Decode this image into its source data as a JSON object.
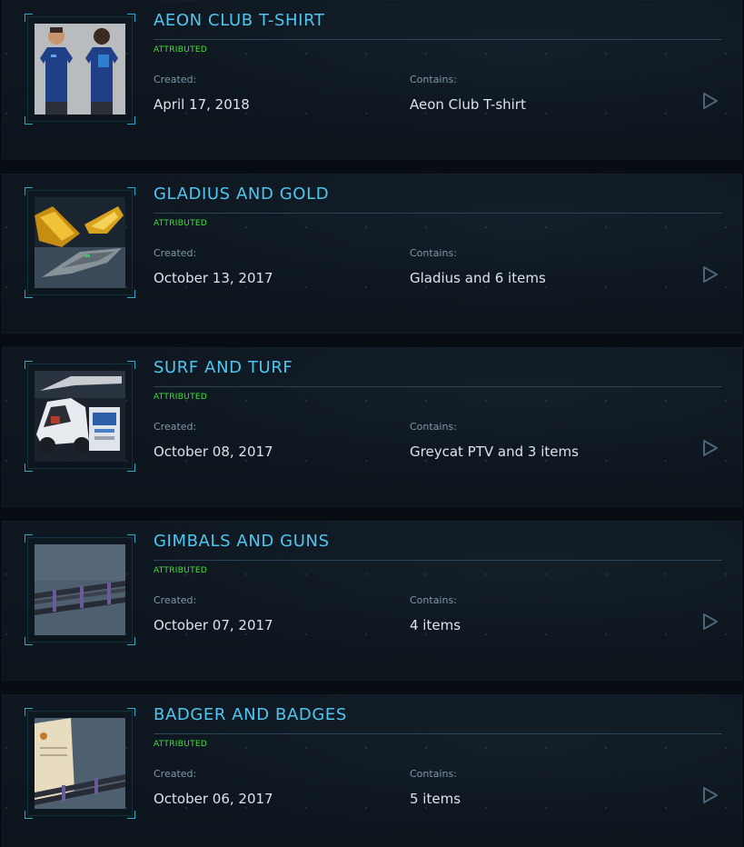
{
  "pledges": [
    {
      "title": "AEON CLUB T-SHIRT",
      "status": "ATTRIBUTED",
      "created_label": "Created:",
      "created": "April 17, 2018",
      "contains_label": "Contains:",
      "contains": "Aeon Club T-shirt",
      "thumbnail": "t-shirt-image"
    },
    {
      "title": "GLADIUS AND GOLD",
      "status": "ATTRIBUTED",
      "created_label": "Created:",
      "created": "October 13, 2017",
      "contains_label": "Contains:",
      "contains": "Gladius and 6 items",
      "thumbnail": "gladius-ship-image"
    },
    {
      "title": "SURF AND TURF",
      "status": "ATTRIBUTED",
      "created_label": "Created:",
      "created": "October 08, 2017",
      "contains_label": "Contains:",
      "contains": "Greycat PTV and 3 items",
      "thumbnail": "greycat-ptv-image"
    },
    {
      "title": "GIMBALS AND GUNS",
      "status": "ATTRIBUTED",
      "created_label": "Created:",
      "created": "October 07, 2017",
      "contains_label": "Contains:",
      "contains": "4 items",
      "thumbnail": "gimbals-guns-image"
    },
    {
      "title": "BADGER AND BADGES",
      "status": "ATTRIBUTED",
      "created_label": "Created:",
      "created": "October 06, 2017",
      "contains_label": "Contains:",
      "contains": "5 items",
      "thumbnail": "badger-badges-image"
    }
  ],
  "colors": {
    "title": "#4fc6f0",
    "status": "#3fe035",
    "accent": "#2aa9c9"
  }
}
